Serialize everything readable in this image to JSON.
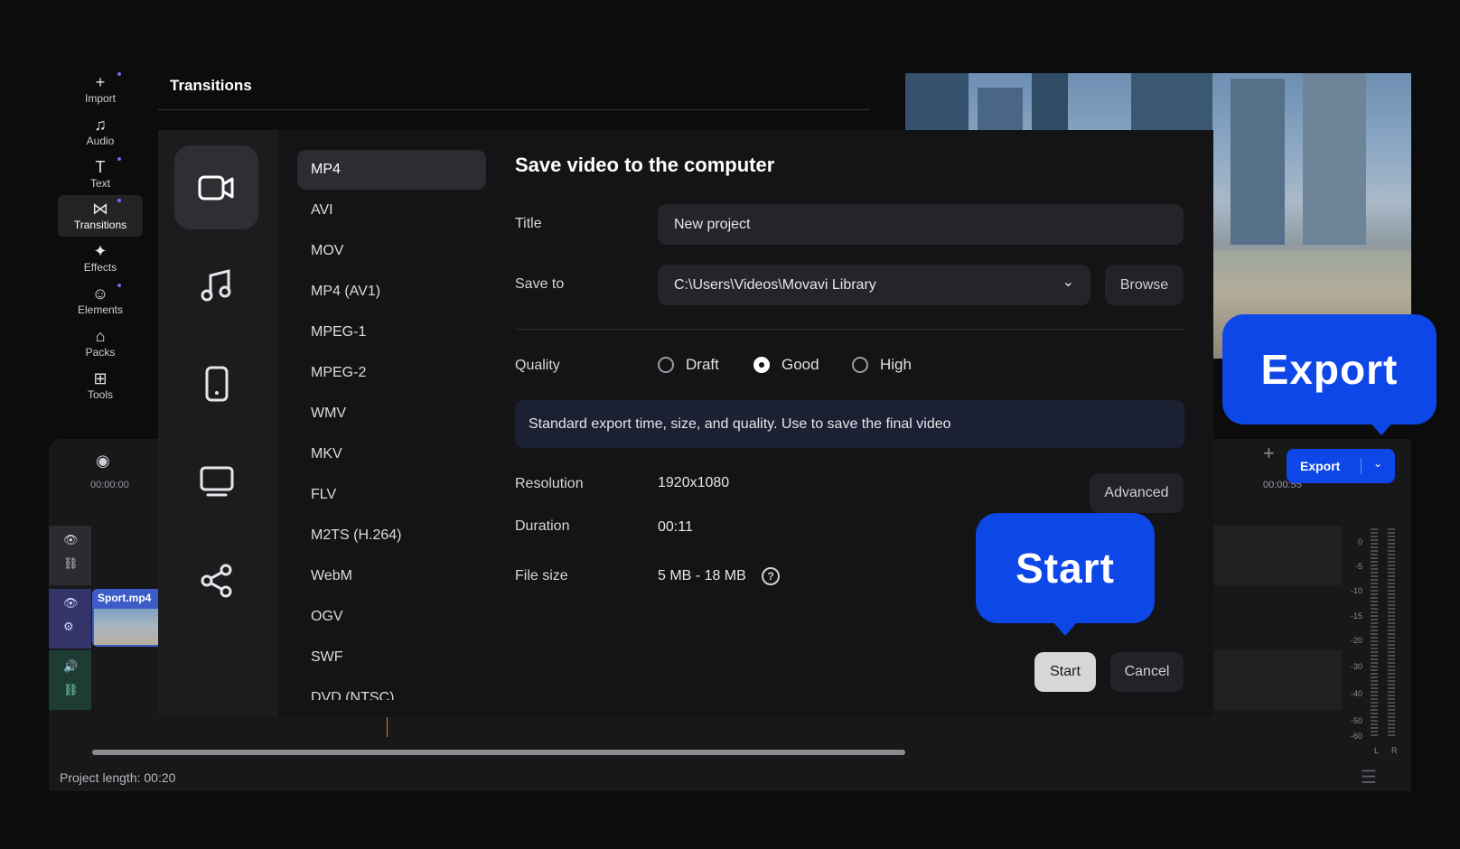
{
  "sidebar": {
    "items": [
      {
        "label": "Import",
        "icon": "plus-icon",
        "glyph": "+"
      },
      {
        "label": "Audio",
        "icon": "music-note-icon",
        "glyph": "♫"
      },
      {
        "label": "Text",
        "icon": "text-icon",
        "glyph": "T"
      },
      {
        "label": "Transitions",
        "icon": "bowtie-icon",
        "glyph": "⋈"
      },
      {
        "label": "Effects",
        "icon": "sparkle-icon",
        "glyph": "✦"
      },
      {
        "label": "Elements",
        "icon": "smiley-icon",
        "glyph": "☺"
      },
      {
        "label": "Packs",
        "icon": "packs-icon",
        "glyph": "⌂"
      },
      {
        "label": "Tools",
        "icon": "grid-plus-icon",
        "glyph": "⊞"
      }
    ]
  },
  "panel": {
    "title": "Transitions"
  },
  "dialog": {
    "heading": "Save video to the computer",
    "formats": [
      "MP4",
      "AVI",
      "MOV",
      "MP4 (AV1)",
      "MPEG-1",
      "MPEG-2",
      "WMV",
      "MKV",
      "FLV",
      "M2TS (H.264)",
      "WebM",
      "OGV",
      "SWF",
      "DVD (NTSC)"
    ],
    "title_label": "Title",
    "title_value": "New project",
    "save_to_label": "Save to",
    "save_to_value": "C:\\Users\\Videos\\Movavi Library",
    "browse_label": "Browse",
    "quality_label": "Quality",
    "quality_options": [
      "Draft",
      "Good",
      "High"
    ],
    "quality_selected": "Good",
    "quality_description": "Standard export time, size, and quality. Use to save the final video",
    "resolution_label": "Resolution",
    "resolution_value": "1920x1080",
    "advanced_label": "Advanced",
    "duration_label": "Duration",
    "duration_value": "00:11",
    "filesize_label": "File size",
    "filesize_value": "5 MB - 18 MB",
    "start_label": "Start",
    "cancel_label": "Cancel"
  },
  "callouts": {
    "export": "Export",
    "start": "Start"
  },
  "timeline": {
    "time_start": "00:00:00",
    "time_end": "00:00:55",
    "clip_name": "Sport.mp4",
    "export_button": "Export",
    "project_length": "Project length: 00:20",
    "vu_scale": [
      "0",
      "-5",
      "-10",
      "-15",
      "-20",
      "-30",
      "-40",
      "-50",
      "-60"
    ],
    "vu_channels": [
      "L",
      "R"
    ]
  },
  "colors": {
    "accent": "#0d47e8",
    "background": "#0c0c0d",
    "dialog": "#141416"
  }
}
